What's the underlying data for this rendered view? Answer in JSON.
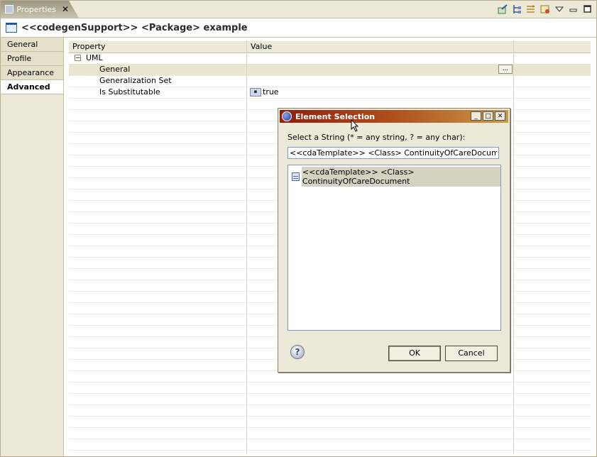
{
  "view": {
    "tab_label": "Properties",
    "tab_close": "✕",
    "title": "<<codegenSupport>> <Package> example"
  },
  "left_tabs": [
    "General",
    "Profile",
    "Appearance",
    "Advanced"
  ],
  "grid": {
    "headers": {
      "property": "Property",
      "value": "Value"
    },
    "group": "UML",
    "group_toggle": "−",
    "rows": [
      {
        "property": "General",
        "value": ""
      },
      {
        "property": "Generalization Set",
        "value": ""
      },
      {
        "property": "Is Substitutable",
        "value": "true"
      }
    ],
    "ellipsis": "..."
  },
  "dialog": {
    "title": "Element Selection",
    "prompt": "Select a String (* = any string, ? = any char):",
    "filter_value": "<<cdaTemplate>> <Class> ContinuityOfCareDocument",
    "items": [
      "<<cdaTemplate>> <Class> ContinuityOfCareDocument"
    ],
    "help": "?",
    "ok": "OK",
    "cancel": "Cancel",
    "minimize": "_",
    "maximize": "□",
    "close": "✕"
  }
}
